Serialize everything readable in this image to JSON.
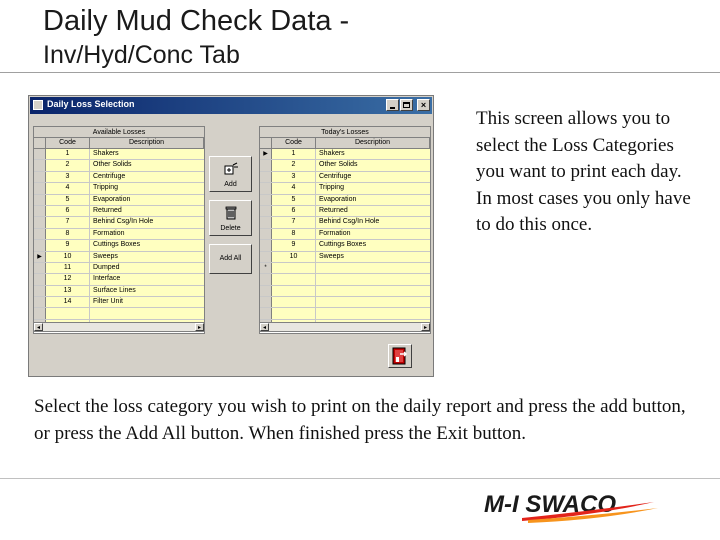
{
  "slide": {
    "title": "Daily Mud Check Data -",
    "subtitle": "Inv/Hyd/Conc Tab",
    "description": "This screen allows you to select the Loss Categories you want to print each day. In most cases you only have to do this once.",
    "instructions": "Select the loss category you wish to print on the daily report and press the add button, or press the Add All button. When finished press the Exit button.",
    "logo_text": "M-I SWACO"
  },
  "window": {
    "title": "Daily Loss Selection",
    "close_glyph": "×"
  },
  "available": {
    "caption": "Available Losses",
    "headers": {
      "code": "Code",
      "description": "Description"
    },
    "rows": [
      {
        "code": "1",
        "description": "Shakers"
      },
      {
        "code": "2",
        "description": "Other Solids"
      },
      {
        "code": "3",
        "description": "Centrifuge"
      },
      {
        "code": "4",
        "description": "Tripping"
      },
      {
        "code": "5",
        "description": "Evaporation"
      },
      {
        "code": "6",
        "description": "Returned"
      },
      {
        "code": "7",
        "description": "Behind Csg/In Hole"
      },
      {
        "code": "8",
        "description": "Formation"
      },
      {
        "code": "9",
        "description": "Cuttings Boxes"
      },
      {
        "code": "10",
        "description": "Sweeps",
        "marker": "▶"
      },
      {
        "code": "11",
        "description": "Dumped"
      },
      {
        "code": "12",
        "description": "Interface"
      },
      {
        "code": "13",
        "description": "Surface Lines"
      },
      {
        "code": "14",
        "description": "Filter Unit"
      }
    ]
  },
  "today": {
    "caption": "Today's Losses",
    "headers": {
      "code": "Code",
      "description": "Description"
    },
    "rows": [
      {
        "code": "1",
        "description": "Shakers",
        "marker": "▶"
      },
      {
        "code": "2",
        "description": "Other Solids"
      },
      {
        "code": "3",
        "description": "Centrifuge"
      },
      {
        "code": "4",
        "description": "Tripping"
      },
      {
        "code": "5",
        "description": "Evaporation"
      },
      {
        "code": "6",
        "description": "Returned"
      },
      {
        "code": "7",
        "description": "Behind Csg/In Hole"
      },
      {
        "code": "8",
        "description": "Formation"
      },
      {
        "code": "9",
        "description": "Cuttings Boxes"
      },
      {
        "code": "10",
        "description": "Sweeps"
      }
    ],
    "new_row_marker": "*"
  },
  "buttons": {
    "add": "Add",
    "delete": "Delete",
    "add_all": "Add All"
  },
  "colors": {
    "cell_bg": "#ffffc0",
    "window_face": "#d4d0c8",
    "titlebar": "#0a246a",
    "logo_red": "#e2231a",
    "logo_orange": "#f7941d"
  }
}
